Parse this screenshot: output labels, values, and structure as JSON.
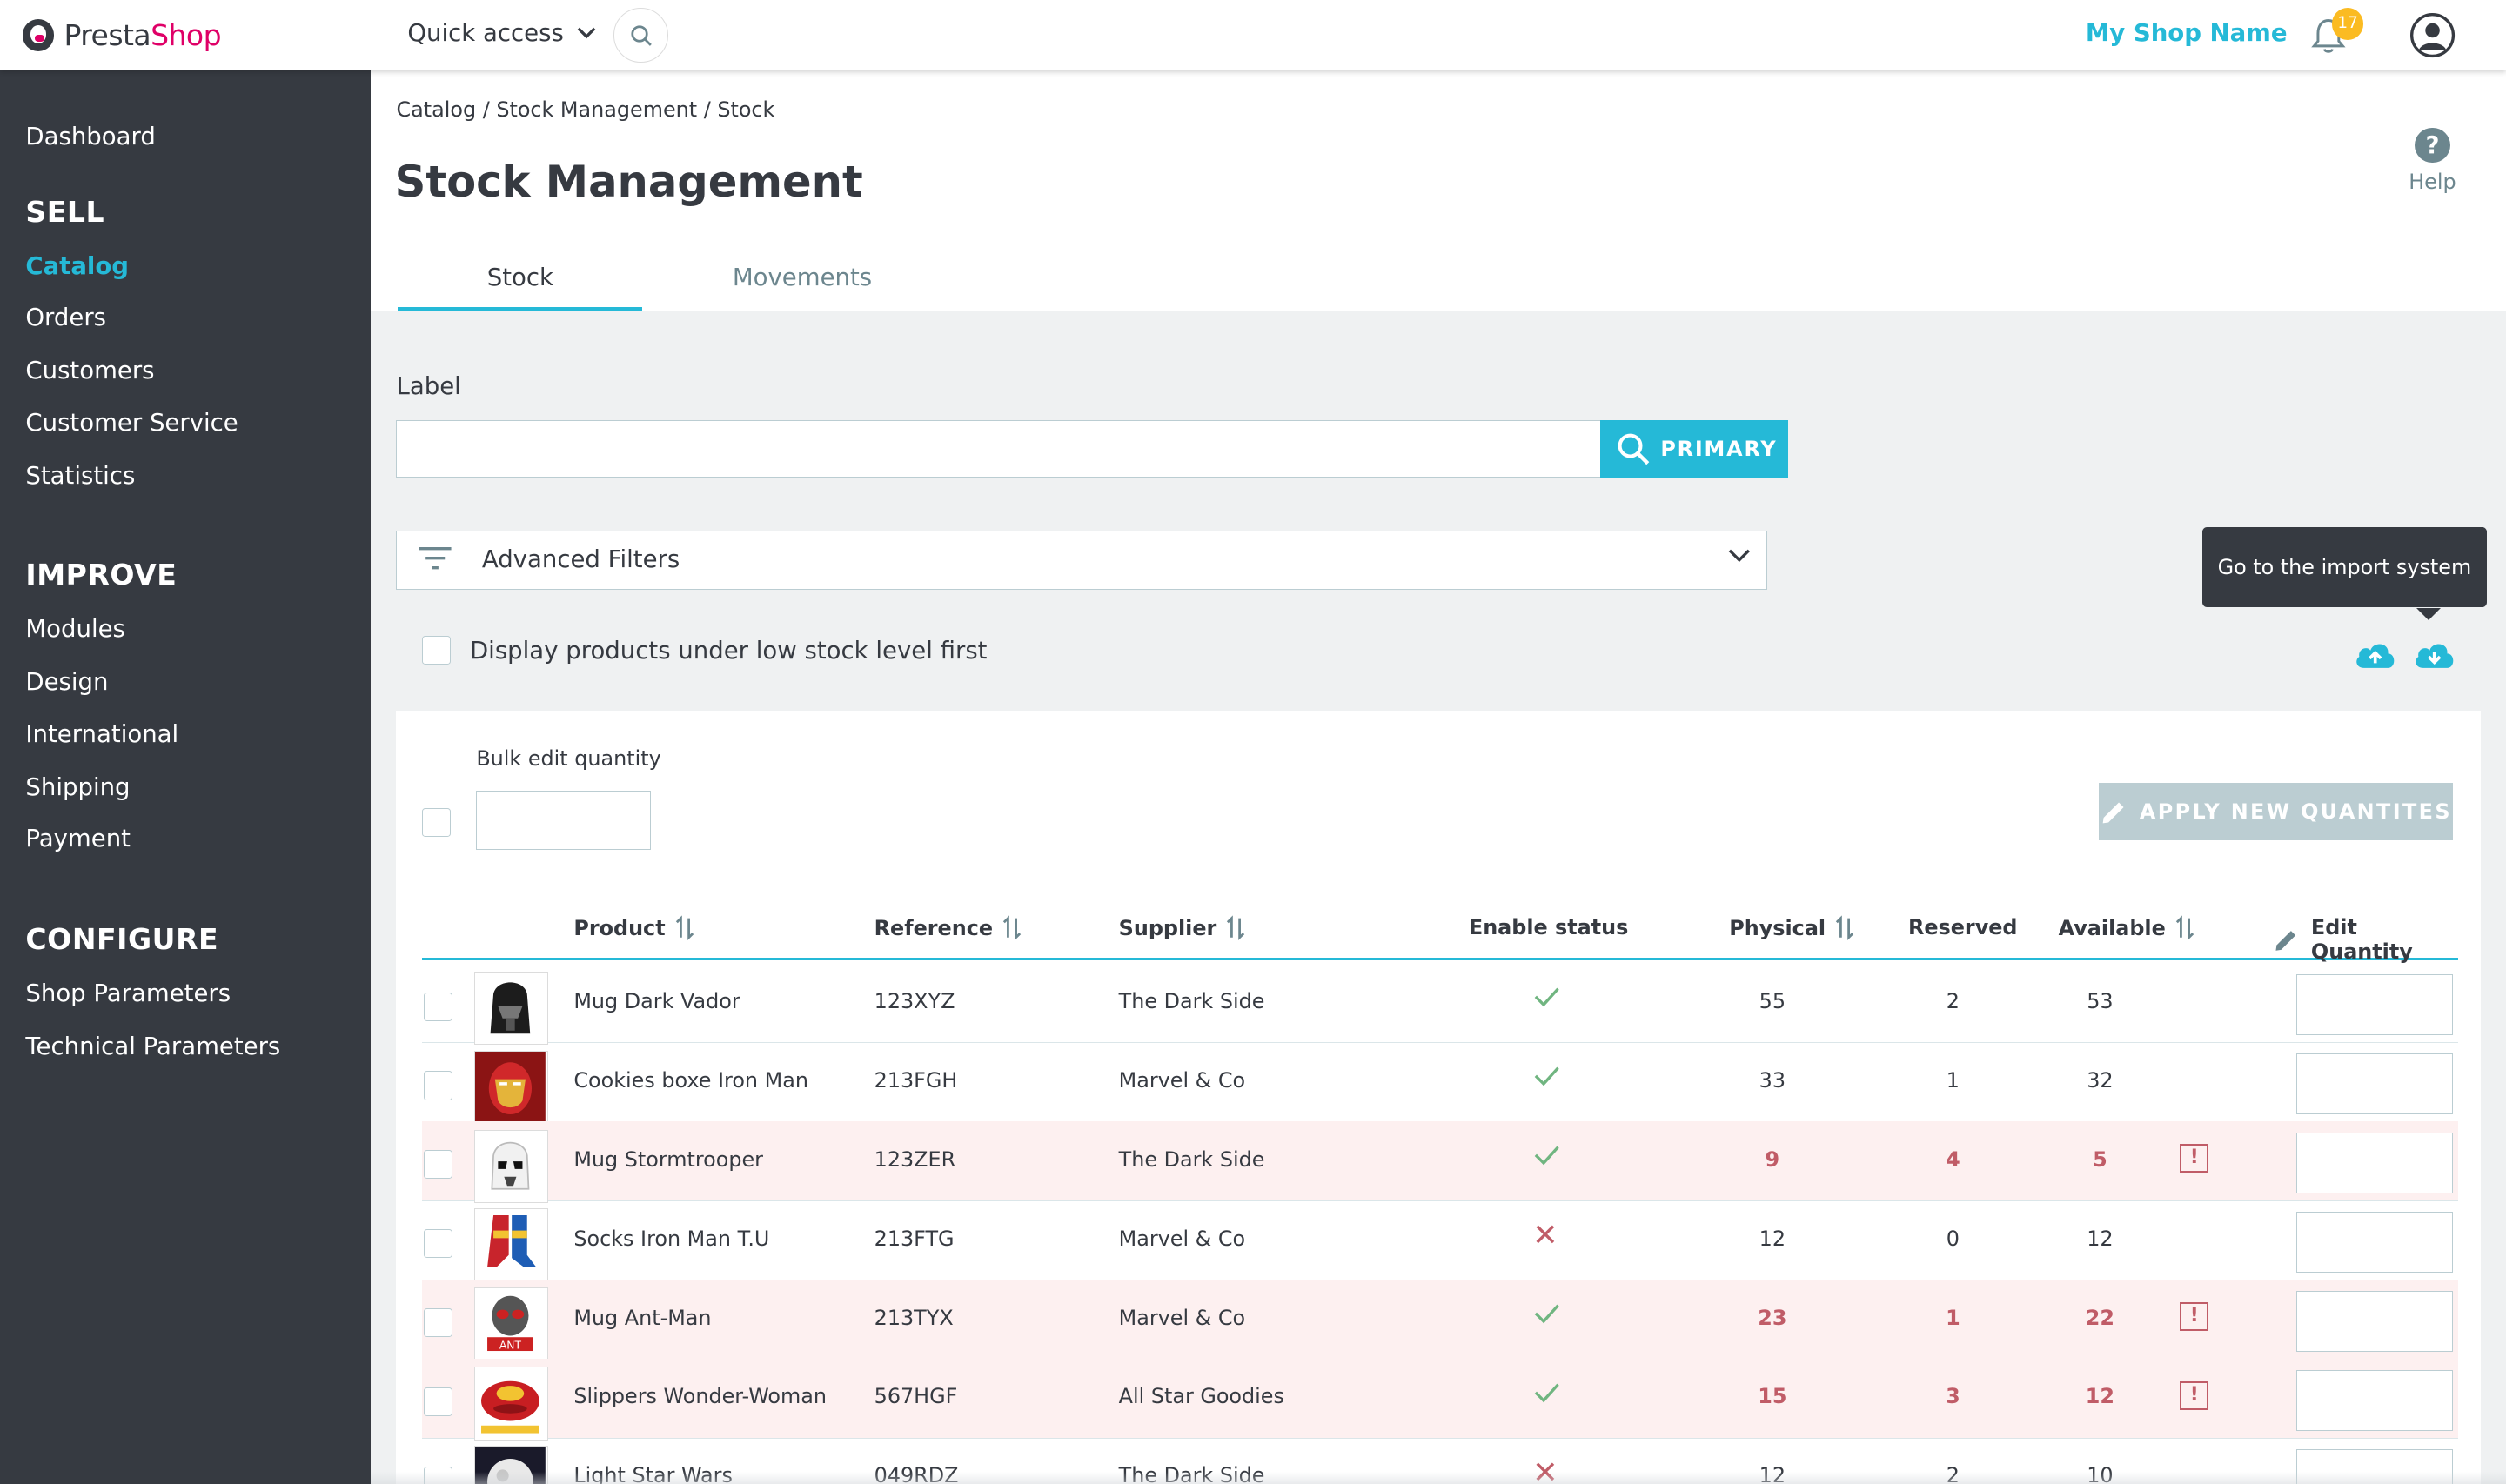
{
  "header": {
    "logo_text_1": "Presta",
    "logo_text_2": "Shop",
    "quick_access": "Quick access",
    "shop_name": "My Shop Name",
    "notifications_count": "17"
  },
  "sidebar": {
    "dashboard": "Dashboard",
    "sell": "SELL",
    "sell_items": [
      "Catalog",
      "Orders",
      "Customers",
      "Customer Service",
      "Statistics"
    ],
    "improve": "IMPROVE",
    "improve_items": [
      "Modules",
      "Design",
      "International",
      "Shipping",
      "Payment"
    ],
    "configure": "CONFIGURE",
    "configure_items": [
      "Shop Parameters",
      "Technical Parameters"
    ],
    "active": "Catalog"
  },
  "page": {
    "breadcrumb": "Catalog / Stock Management / Stock",
    "title": "Stock Management",
    "help": "Help",
    "tabs": [
      "Stock",
      "Movements"
    ]
  },
  "filters": {
    "label": "Label",
    "search_placeholder": "",
    "search_button": "PRIMARY",
    "advanced_filters": "Advanced Filters",
    "low_stock_checkbox": "Display products under low stock level first",
    "tooltip": "Go to the import system"
  },
  "bulk": {
    "label": "Bulk edit quantity",
    "apply_button": "APPLY NEW QUANTITES"
  },
  "table": {
    "columns": {
      "product": "Product",
      "reference": "Reference",
      "supplier": "Supplier",
      "enable_status": "Enable status",
      "physical": "Physical",
      "reserved": "Reserved",
      "available": "Available",
      "edit_quantity": "Edit Quantity"
    },
    "rows": [
      {
        "product": "Mug Dark Vador",
        "reference": "123XYZ",
        "supplier": "The Dark Side",
        "enabled": true,
        "physical": "55",
        "reserved": "2",
        "available": "53",
        "low": false
      },
      {
        "product": "Cookies boxe Iron Man",
        "reference": "213FGH",
        "supplier": "Marvel & Co",
        "enabled": true,
        "physical": "33",
        "reserved": "1",
        "available": "32",
        "low": false
      },
      {
        "product": "Mug Stormtrooper",
        "reference": "123ZER",
        "supplier": "The Dark Side",
        "enabled": true,
        "physical": "9",
        "reserved": "4",
        "available": "5",
        "low": true
      },
      {
        "product": "Socks Iron Man T.U",
        "reference": "213FTG",
        "supplier": "Marvel & Co",
        "enabled": false,
        "physical": "12",
        "reserved": "0",
        "available": "12",
        "low": false
      },
      {
        "product": "Mug Ant-Man",
        "reference": "213TYX",
        "supplier": "Marvel & Co",
        "enabled": true,
        "physical": "23",
        "reserved": "1",
        "available": "22",
        "low": true
      },
      {
        "product": "Slippers Wonder-Woman",
        "reference": "567HGF",
        "supplier": "All Star Goodies",
        "enabled": true,
        "physical": "15",
        "reserved": "3",
        "available": "12",
        "low": true
      },
      {
        "product": "Light Star Wars",
        "reference": "049RDZ",
        "supplier": "The Dark Side",
        "enabled": false,
        "physical": "12",
        "reserved": "2",
        "available": "10",
        "low": false
      }
    ]
  },
  "colors": {
    "accent": "#25b9d7",
    "sidebar_bg": "#363a41",
    "low_stock_bg": "#fdf0f0",
    "low_stock_text": "#c05c67",
    "notification_badge": "#fbbb22"
  }
}
